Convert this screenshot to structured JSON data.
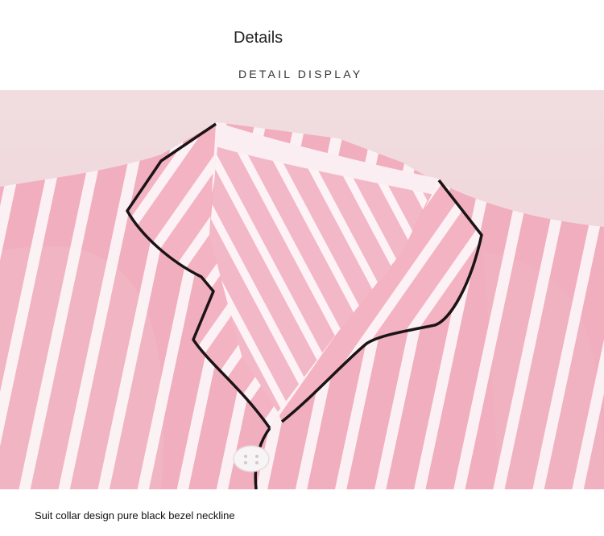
{
  "header": {
    "title": "Details",
    "subtitle": "DETAIL DISPLAY"
  },
  "photo": {
    "subject": "pink-white-striped-satin-pajama-collar",
    "colors": {
      "background": "#f2d4da",
      "pink_stripe": "#f0aebe",
      "white_stripe": "#fbf1f4",
      "piping": "#1b1416",
      "button": "#f7f4f5"
    }
  },
  "caption": {
    "text": "Suit collar design pure black bezel neckline"
  }
}
